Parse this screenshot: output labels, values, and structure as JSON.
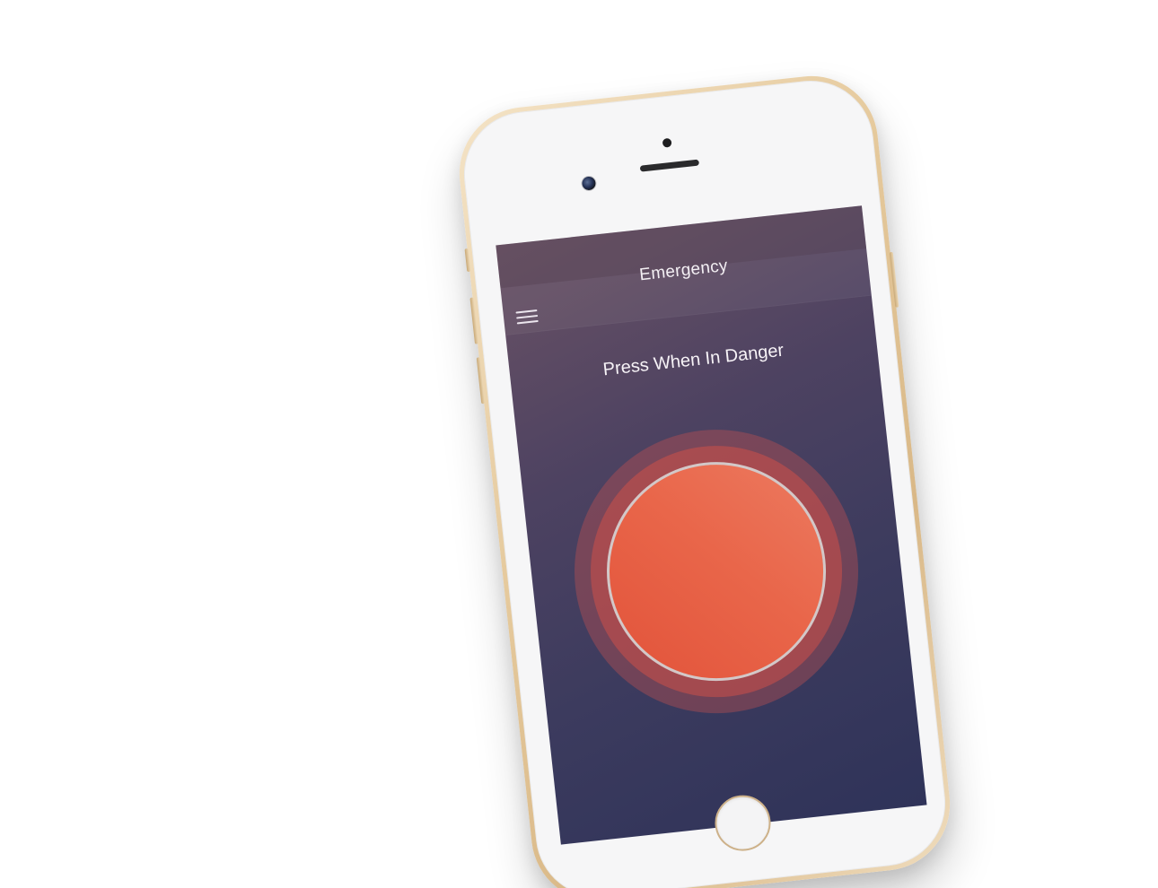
{
  "app": {
    "header": {
      "title": "Emergency",
      "menu_icon": "hamburger-menu-icon"
    },
    "main": {
      "prompt": "Press When In Danger",
      "alarm_button_icon": "emergency-alert-button"
    },
    "colors": {
      "screen_top": "#6a5265",
      "screen_bottom": "#2f3359",
      "alarm_button": "#e9664a",
      "alarm_ring": "#cd5048",
      "phone_frame": "#e5c99c"
    }
  }
}
